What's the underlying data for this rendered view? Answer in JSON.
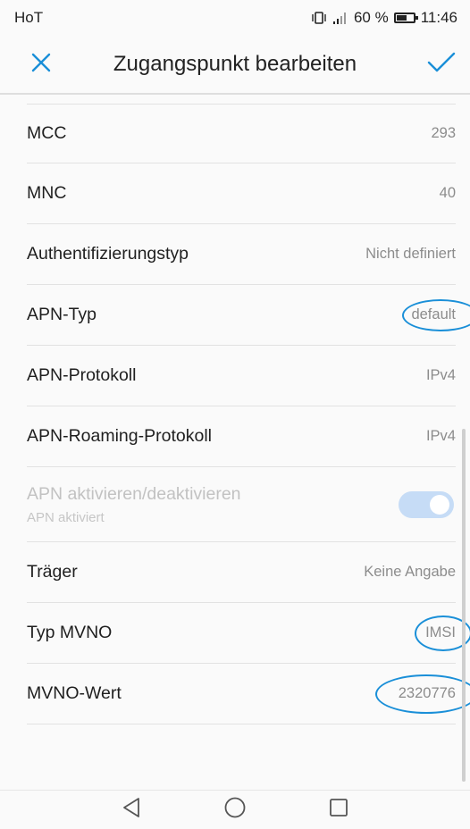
{
  "status": {
    "carrier": "HoT",
    "battery": "60 %",
    "battery_level": 0.6,
    "time": "11:46"
  },
  "appbar": {
    "title": "Zugangspunkt bearbeiten",
    "close_icon": "close-icon",
    "confirm_icon": "check-icon"
  },
  "rows": [
    {
      "label": "MCC",
      "value": "293"
    },
    {
      "label": "MNC",
      "value": "40"
    },
    {
      "label": "Authentifizierungstyp",
      "value": "Nicht definiert"
    },
    {
      "label": "APN-Typ",
      "value": "default"
    },
    {
      "label": "APN-Protokoll",
      "value": "IPv4"
    },
    {
      "label": "APN-Roaming-Protokoll",
      "value": "IPv4"
    },
    {
      "label": "APN aktivieren/deaktivieren",
      "subtitle": "APN aktiviert",
      "enabled": true
    },
    {
      "label": "Träger",
      "value": "Keine Angabe"
    },
    {
      "label": "Typ MVNO",
      "value": "IMSI"
    },
    {
      "label": "MVNO-Wert",
      "value": "2320776"
    }
  ],
  "colors": {
    "annotation": "#1a8fd8",
    "toggle_track": "#c6dcf6",
    "accent": "#1a8fd8"
  },
  "navbar": {
    "back": "back-triangle-icon",
    "home": "home-circle-icon",
    "recents": "recents-square-icon"
  }
}
